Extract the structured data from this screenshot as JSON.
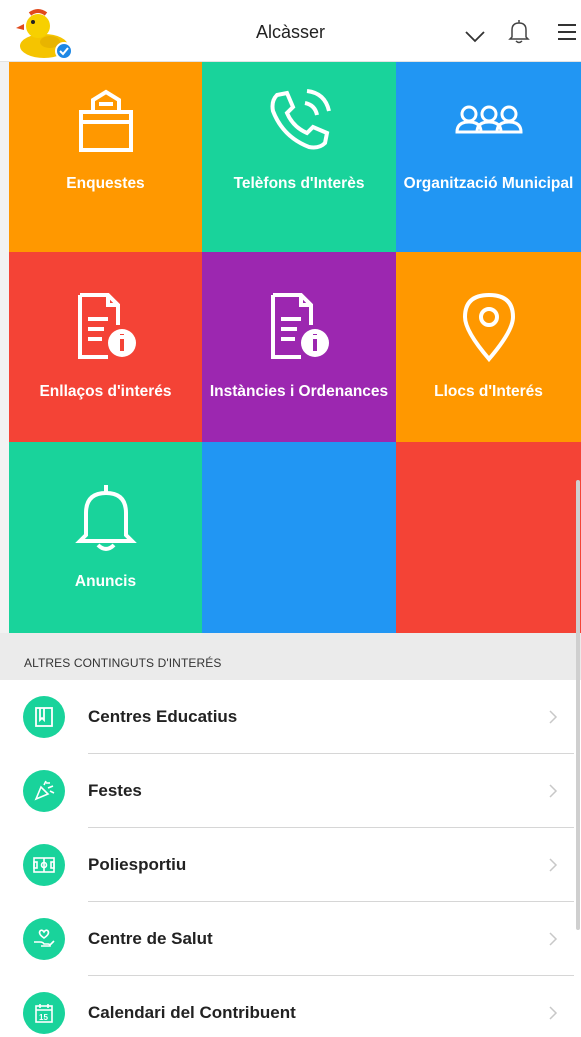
{
  "header": {
    "title": "Alcàsser",
    "avatar_icon": "duck-avatar-icon",
    "dropdown_icon": "chevron-down-icon",
    "bell_icon": "bell-icon",
    "menu_icon": "hamburger-menu-icon"
  },
  "tiles": [
    {
      "label": "Enquestes",
      "color": "#ff9800",
      "icon": "ballot-box-icon"
    },
    {
      "label": "Telèfons d'Interès",
      "color": "#19d39b",
      "icon": "phone-icon"
    },
    {
      "label": "Organització Municipal",
      "color": "#2196f3",
      "icon": "people-icon"
    },
    {
      "label": "Enllaços d'interés",
      "color": "#f44336",
      "icon": "document-info-icon"
    },
    {
      "label": "Instàncies i Ordenances",
      "color": "#9c27b0",
      "icon": "document-info-icon"
    },
    {
      "label": "Llocs d'Interés",
      "color": "#ff9800",
      "icon": "location-pin-icon"
    },
    {
      "label": "Anuncis",
      "color": "#19d39b",
      "icon": "bell-icon"
    },
    {
      "label": "",
      "color": "#2196f3",
      "icon": ""
    },
    {
      "label": "",
      "color": "#f44336",
      "icon": ""
    }
  ],
  "section": {
    "title": "ALTRES CONTINGUTS D'INTERÉS"
  },
  "list": [
    {
      "label": "Centres Educatius",
      "icon": "school-icon"
    },
    {
      "label": "Festes",
      "icon": "party-popper-icon"
    },
    {
      "label": "Poliesportiu",
      "icon": "sports-field-icon"
    },
    {
      "label": "Centre de Salut",
      "icon": "health-hand-icon"
    },
    {
      "label": "Calendari del Contribuent",
      "icon": "calendar-icon"
    }
  ],
  "colors": {
    "accent_green": "#19d39b",
    "orange": "#ff9800",
    "blue": "#2196f3",
    "red": "#f44336",
    "purple": "#9c27b0"
  }
}
